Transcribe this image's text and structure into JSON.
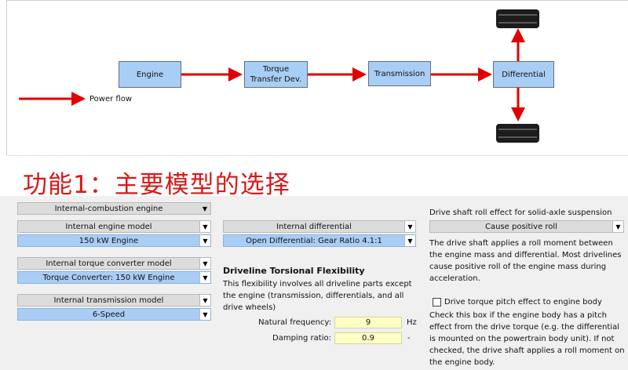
{
  "diagram": {
    "nodes": {
      "engine": "Engine",
      "torque_line1": "Torque",
      "torque_line2": "Transfer Dev.",
      "transmission": "Transmission",
      "differential": "Differential"
    },
    "legend_label": "Power flow",
    "colors": {
      "arrow": "#e00000",
      "node_fill": "#a9cef5"
    }
  },
  "feature_title": "功能1：主要模型的选择",
  "models": {
    "engine_type": "Internal-combustion engine",
    "engine_model_label": "Internal engine model",
    "engine_model_value": "150 kW Engine",
    "torque_converter_label": "Internal torque converter model",
    "torque_converter_value": "Torque Converter: 150 kW Engine",
    "transmission_label": "Internal transmission model",
    "transmission_value": "6-Speed",
    "differential_label": "Internal differential",
    "differential_value": "Open Differential: Gear Ratio 4.1:1"
  },
  "flexibility": {
    "title": "Driveline Torsional Flexibility",
    "description": "This flexibility involves all driveline parts except the engine (transmission, differentials, and all drive wheels)",
    "natural_frequency_label": "Natural frequency:",
    "natural_frequency_value": "9",
    "natural_frequency_unit": "Hz",
    "damping_ratio_label": "Damping ratio:",
    "damping_ratio_value": "0.9",
    "damping_ratio_unit": "-"
  },
  "roll_effect": {
    "title": "Drive shaft roll effect for solid-axle suspension",
    "value": "Cause positive roll",
    "description": "The drive shaft applies a roll moment between the engine mass and differential.  Most drivelines cause positive roll of the engine mass during acceleration.",
    "pitch_label": "Drive torque pitch effect to engine body",
    "pitch_checked": false,
    "pitch_description": "Check this box if the engine body has a pitch effect from the drive torque (e.g. the differential is mounted on the powertrain body unit). If not checked, the drive shaft applies a roll moment on the engine body."
  }
}
